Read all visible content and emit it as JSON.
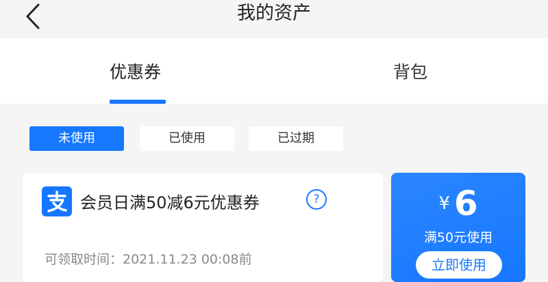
{
  "header": {
    "title": "我的资产",
    "back_icon": "chevron-left-icon"
  },
  "tabs": [
    {
      "label": "优惠券",
      "active": true
    },
    {
      "label": "背包",
      "active": false
    }
  ],
  "filters": [
    {
      "label": "未使用",
      "active": true
    },
    {
      "label": "已使用",
      "active": false
    },
    {
      "label": "已过期",
      "active": false
    }
  ],
  "coupon": {
    "logo_icon": "alipay-logo-icon",
    "name": "会员日满50减6元优惠券",
    "help_symbol": "?",
    "claim_time": "可领取时间：2021.11.23 00:08前",
    "currency": "¥",
    "amount": "6",
    "threshold": "满50元使用",
    "use_button": "立即使用"
  },
  "colors": {
    "accent": "#1677ff",
    "background": "#f5f5f5",
    "card": "#ffffff"
  }
}
